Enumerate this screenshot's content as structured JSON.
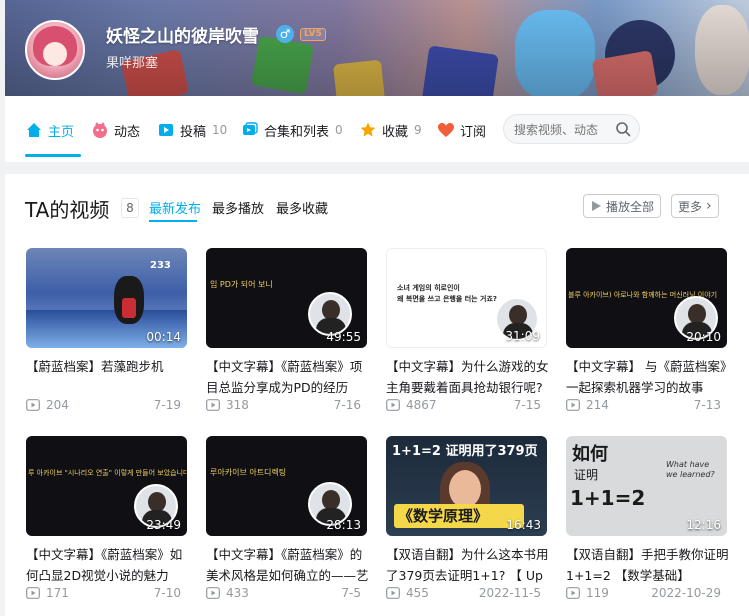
{
  "profile": {
    "username": "妖怪之山的彼岸吹雪",
    "gender_icon": "male-icon",
    "gender_glyph": "♂",
    "level": "LV5",
    "sign": "果咩那塞"
  },
  "nav": {
    "items": [
      {
        "label": "主页",
        "icon": "home-icon",
        "count": "",
        "active": true
      },
      {
        "label": "动态",
        "icon": "dynamic-icon",
        "count": ""
      },
      {
        "label": "投稿",
        "icon": "upload-icon",
        "count": "10"
      },
      {
        "label": "合集和列表",
        "icon": "collection-icon",
        "count": "0"
      },
      {
        "label": "收藏",
        "icon": "star-icon",
        "count": "9"
      },
      {
        "label": "订阅",
        "icon": "heart-icon",
        "count": ""
      }
    ],
    "search_placeholder": "搜索视频、动态"
  },
  "videos_section": {
    "title": "TA的视频",
    "count": "8",
    "sort_tabs": [
      "最新发布",
      "最多播放",
      "最多收藏"
    ],
    "play_all": "播放全部",
    "more": "更多",
    "more_glyph": "›",
    "items": [
      {
        "title": "【蔚蓝档案】若藻跑步机",
        "duration": "00:14",
        "views": "204",
        "date": "7-19"
      },
      {
        "title": "【中文字幕】《蔚蓝档案》项目总监分享成为PD的经历",
        "duration": "49:55",
        "views": "318",
        "date": "7-16"
      },
      {
        "title": "【中文字幕】为什么游戏的女主角要戴着面具抢劫银行呢?",
        "duration": "31:09",
        "views": "4867",
        "date": "7-15"
      },
      {
        "title": "【中文字幕】 与《蔚蓝档案》一起探索机器学习的故事",
        "duration": "20:10",
        "views": "214",
        "date": "7-13"
      },
      {
        "title": "【中文字幕】《蔚蓝档案》如何凸显2D视觉小说的魅力",
        "duration": "23:49",
        "views": "171",
        "date": "7-10"
      },
      {
        "title": "【中文字幕】《蔚蓝档案》的美术风格是如何确立的——艺",
        "duration": "28:13",
        "views": "433",
        "date": "7-5"
      },
      {
        "title": "【双语自翻】为什么这本书用了379页去证明1+1? 【 Up",
        "duration": "16:43",
        "views": "455",
        "date": "2022-11-5"
      },
      {
        "title": "【双语自翻】手把手教你证明1+1=2 【数学基础】",
        "duration": "12:16",
        "views": "119",
        "date": "2022-10-29"
      }
    ]
  },
  "thumb_text": {
    "t2_banner": "임 PD가 되어 보니",
    "t3_line1": "소녀 게임의 히로인이",
    "t3_line2": "왜 복면을 쓰고 은행을 터는 거죠?",
    "t4_banner": "블루 아카이브) 아로나와 함께하는 머신러닝 이야기",
    "t5_banner": "루 아카이브 \"시나리오 연출\" 이렇게 만들어 보았습니다",
    "t6_banner": "루아카이브 아트디렉팅",
    "t7_headline": "1+1=2 证明用了379页",
    "t7_caption": "《数学原理》",
    "t8_line1": "如何",
    "t8_line2": "证明",
    "t8_line3": "1+1=2",
    "t8_note": "What have we learned?",
    "t1_score": "233"
  }
}
